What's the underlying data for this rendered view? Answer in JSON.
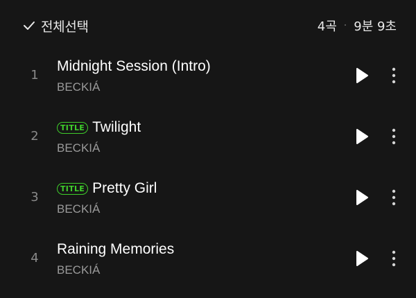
{
  "header": {
    "select_all_label": "전체선택",
    "track_count": "4곡",
    "total_duration": "9분 9초",
    "separator": "·"
  },
  "tracks": [
    {
      "number": "1",
      "title": "Midnight Session (Intro)",
      "artist": "BECKIÁ",
      "badge": ""
    },
    {
      "number": "2",
      "title": "Twilight",
      "artist": "BECKIÁ",
      "badge": "TITLE"
    },
    {
      "number": "3",
      "title": "Pretty Girl",
      "artist": "BECKIÁ",
      "badge": "TITLE"
    },
    {
      "number": "4",
      "title": "Raining Memories",
      "artist": "BECKIÁ",
      "badge": ""
    }
  ],
  "icons": {
    "select_all": "check-icon",
    "play": "play-icon",
    "more": "more-vertical-icon"
  },
  "colors": {
    "background": "#161616",
    "accent": "#3fce2b",
    "primary_text": "#ffffff",
    "secondary_text": "#9a9a9a"
  }
}
